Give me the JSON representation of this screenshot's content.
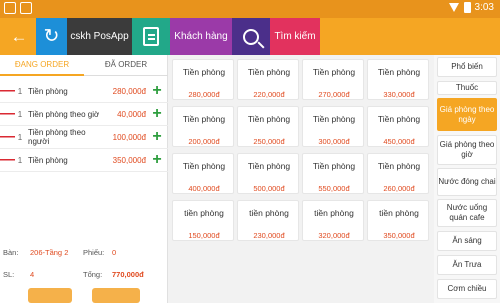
{
  "status": {
    "time": "3:03"
  },
  "toolbar": {
    "back_glyph": "←",
    "refresh_glyph": "↻",
    "cskh_label": "cskh PosApp",
    "khach_label": "Khách hàng",
    "timkiem_label": "Tìm kiếm"
  },
  "tabs": {
    "dang_order": "ĐANG ORDER",
    "da_order": "ĐÃ ORDER"
  },
  "order_items": [
    {
      "minus": "—",
      "qty": "1",
      "name": "Tiền phòng",
      "price": "280,000đ",
      "plus": "+"
    },
    {
      "minus": "—",
      "qty": "1",
      "name": "Tiền phòng theo giờ",
      "price": "40,000đ",
      "plus": "+"
    },
    {
      "minus": "—",
      "qty": "1",
      "name": "Tiền phòng theo người",
      "price": "100,000đ",
      "plus": "+"
    },
    {
      "minus": "—",
      "qty": "1",
      "name": "Tiền phòng",
      "price": "350,000đ",
      "plus": "+"
    }
  ],
  "summary": {
    "ban_label": "Bàn:",
    "ban_value": "206-Tầng 2",
    "phieu_label": "Phiếu:",
    "phieu_value": "0",
    "sl_label": "SL:",
    "sl_value": "4",
    "tong_label": "Tổng:",
    "tong_value": "770,000đ"
  },
  "products": [
    {
      "name": "Tiền phòng",
      "price": "280,000đ"
    },
    {
      "name": "Tiền phòng",
      "price": "220,000đ"
    },
    {
      "name": "Tiền phòng",
      "price": "270,000đ"
    },
    {
      "name": "Tiền phòng",
      "price": "330,000đ"
    },
    {
      "name": "Tiền phòng",
      "price": "200,000đ"
    },
    {
      "name": "Tiền phòng",
      "price": "250,000đ"
    },
    {
      "name": "Tiền phòng",
      "price": "300,000đ"
    },
    {
      "name": "Tiền phòng",
      "price": "450,000đ"
    },
    {
      "name": "Tiền phòng",
      "price": "400,000đ"
    },
    {
      "name": "Tiền phòng",
      "price": "500,000đ"
    },
    {
      "name": "Tiền phòng",
      "price": "550,000đ"
    },
    {
      "name": "Tiền phòng",
      "price": "260,000đ"
    },
    {
      "name": "tiền phòng",
      "price": "150,000đ"
    },
    {
      "name": "tiền phòng",
      "price": "230,000đ"
    },
    {
      "name": "tiền phòng",
      "price": "320,000đ"
    },
    {
      "name": "tiền phòng",
      "price": "350,000đ"
    }
  ],
  "categories": [
    {
      "label": "Phổ biến"
    },
    {
      "label": "Thuốc"
    },
    {
      "label": "Giá phòng theo ngày",
      "active": true
    },
    {
      "label": "Giá phòng theo giờ"
    },
    {
      "label": "Nước đóng chai"
    },
    {
      "label": "Nước uống quán cafe"
    },
    {
      "label": "Ăn sáng"
    },
    {
      "label": "Ăn Trưa"
    },
    {
      "label": "Cơm chiều"
    }
  ],
  "colors": {
    "accent": "#f5a623",
    "status_bar": "#e8931c",
    "price": "#e04a1f",
    "minus": "#d9262f",
    "plus": "#2e9e3f"
  }
}
